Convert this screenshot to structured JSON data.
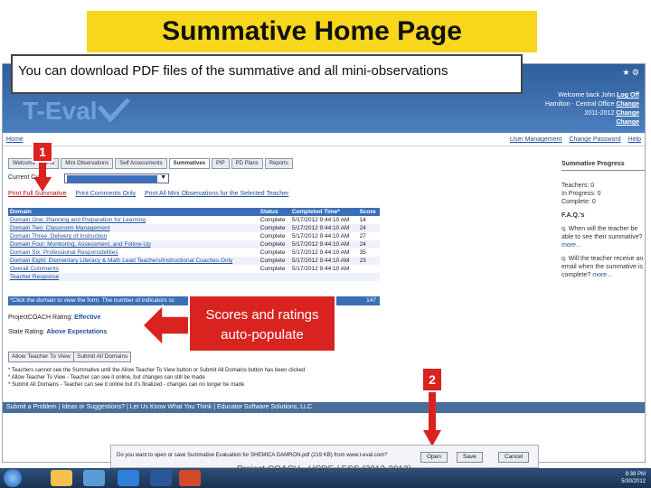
{
  "slide": {
    "title": "Summative Home Page",
    "callout": "You can download PDF files of the summative and all mini-observations",
    "badge_1": "1",
    "badge_2": "2",
    "scores_callout": "Scores and ratings auto-populate",
    "footer": "Project COACH - HCDE / ESS (2012-2013)"
  },
  "app": {
    "logo": "T-Eval",
    "header_right": {
      "welcome": "Welcome back John",
      "logoff": "Log Off",
      "school": "Hamilton - Central Office",
      "change1": "Change",
      "year": "2011-2012",
      "change2": "Change",
      "change3": "Change"
    },
    "nav": {
      "home": "Home",
      "links": [
        "User Management",
        "Change Password",
        "Help"
      ]
    },
    "tabs": [
      "Welcome",
      "Pre",
      "Mini Observations",
      "Self Assessments",
      "Summatives",
      "PIP",
      "PD Plans",
      "Reports"
    ],
    "active_tab": 4,
    "cycle_label": "Current Cycle",
    "print_links": {
      "full": "Print Full Summative",
      "comments": "Print Comments Only",
      "all_mini": "Print All Mini Observations for the Selected Teacher"
    },
    "table": {
      "headers": [
        "Domain",
        "Status",
        "Completed Time*",
        "Score"
      ],
      "rows": [
        [
          "Domain One: Planning and Preparation for Learning",
          "Complete",
          "5/17/2012 9:44:10 AM",
          "14"
        ],
        [
          "Domain Two: Classroom Management",
          "Complete",
          "5/17/2012 9:44:10 AM",
          "24"
        ],
        [
          "Domain Three: Delivery of Instruction",
          "Complete",
          "5/17/2012 9:44:10 AM",
          "27"
        ],
        [
          "Domain Four: Monitoring, Assessment, and Follow-Up",
          "Complete",
          "5/17/2012 9:44:10 AM",
          "24"
        ],
        [
          "Domain Six: Professional Responsibilities",
          "Complete",
          "5/17/2012 9:44:10 AM",
          "35"
        ],
        [
          "Domain Eight: Elementary Literacy & Math Lead Teachers/Instructional Coaches Only",
          "Complete",
          "5/17/2012 9:44:10 AM",
          "23"
        ],
        [
          "Overall Comments",
          "Complete",
          "5/17/2012 9:44:10 AM",
          ""
        ],
        [
          "Teacher Response",
          "",
          "",
          ""
        ]
      ],
      "note": "*Click the domain to view the form. The number of indicators sc",
      "total": "147"
    },
    "project_rating_label": "ProjectCOACH Rating:",
    "project_rating_value": "Effective",
    "state_rating_label": "State Rating:",
    "state_rating_value": "Above Expectations",
    "buttons": {
      "allow_view": "Allow Teacher To View",
      "submit_all": "Submit All Domains"
    },
    "footnotes": [
      "* Teachers cannot see the Summative until the Allow Teacher To View button or Submit All Domains button has been clicked",
      "* Allow Teacher To View - Teacher can see it online, but changes can still be made",
      "* Submit All Domains - Teacher can see it online but it's finalized - changes can no longer be made"
    ],
    "status_bar": "Submit a Problem | Ideas or Suggestions? | Let Us Know What You Think | Educator Software Solutions, LLC",
    "sidebar": {
      "title": "Summative Progress",
      "teachers": "Teachers: 0",
      "in_progress": "In Progress: 0",
      "complete": "Complete: 0",
      "faq": "F.A.Q.'s",
      "q1": "When will the teacher be able to see their summative?",
      "q2": "Will the teacher receive an email when the summative is complete?",
      "more": "more..."
    },
    "download": {
      "text": "Do you want to open or save Summative Evaluation for SHEMICA DAMRON.pdf (219 KB) from www.t-eval.com?",
      "open": "Open",
      "save": "Save",
      "cancel": "Cancel"
    },
    "clock": {
      "time": "8:38 PM",
      "date": "5/30/2012"
    }
  },
  "colors": {
    "title_bg": "#f7d61c",
    "callout_red": "#d9231f",
    "header_blue": "#2f5f9b"
  }
}
